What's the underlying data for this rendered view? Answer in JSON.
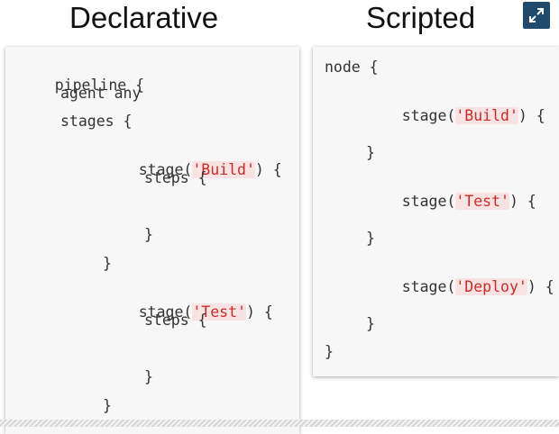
{
  "titles": {
    "declarative": "Declarative",
    "scripted": "Scripted"
  },
  "expand_icon": "expand-arrows-icon",
  "declarative": {
    "pipeline_kw": "pipeline",
    "open1": " {",
    "agent": "agent any",
    "stages": "stages {",
    "stage_build_prefix": "stage(",
    "stage_build_str": "'Build'",
    "stage_build_suffix": ") {",
    "steps1": "steps {",
    "close_steps1": "}",
    "close_stage1": "}",
    "stage_test_prefix": "stage(",
    "stage_test_str": "'Test'",
    "stage_test_suffix": ") {",
    "steps2": "steps {",
    "close_steps2": "}",
    "close_stage2": "}"
  },
  "scripted": {
    "node": "node {",
    "stage_build_prefix": "stage(",
    "stage_build_str": "'Build'",
    "stage_build_suffix": ") {",
    "close_build": "}",
    "stage_test_prefix": "stage(",
    "stage_test_str": "'Test'",
    "stage_test_suffix": ") {",
    "close_test": "}",
    "stage_deploy_prefix": "stage(",
    "stage_deploy_str": "'Deploy'",
    "stage_deploy_suffix": ") {",
    "close_deploy": "}",
    "close_node": "}"
  },
  "colors": {
    "accent_button": "#1f4a6b",
    "string_text": "#cc2a2a",
    "string_bg": "#f8e3e3",
    "code_text": "#333333",
    "panel_bg": "#f7f7f7"
  }
}
